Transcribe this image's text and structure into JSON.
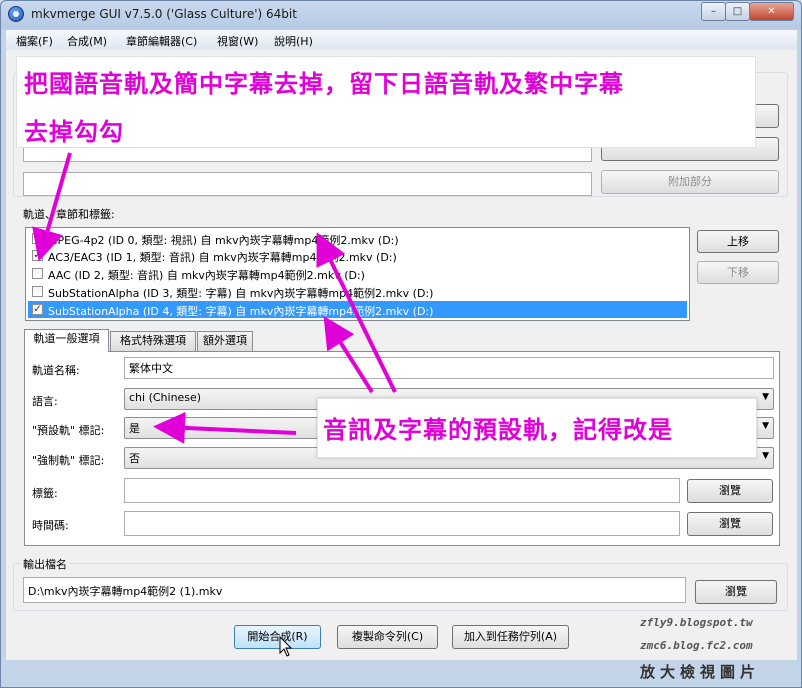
{
  "window": {
    "title": "mkvmerge GUI v7.5.0 ('Glass Culture') 64bit",
    "controls": {
      "minimize": "–",
      "maximize": "□",
      "close": "✕"
    }
  },
  "menu": [
    "檔案(F)",
    "合成(M)",
    "章節編輯器(C)",
    "視窗(W)",
    "說明(H)"
  ],
  "upper": {
    "append_button": "附加部分"
  },
  "tracks": {
    "label": "軌道、章節和標籤:",
    "items": [
      {
        "checked": true,
        "text": "MPEG-4p2 (ID 0, 類型: 視訊) 自 mkv內崁字幕轉mp4範例2.mkv (D:)",
        "selected": false
      },
      {
        "checked": true,
        "text": "AC3/EAC3 (ID 1, 類型: 音訊) 自 mkv內崁字幕轉mp4範例2.mkv (D:)",
        "selected": false
      },
      {
        "checked": false,
        "text": "AAC (ID 2, 類型: 音訊) 自 mkv內崁字幕轉mp4範例2.mkv (D:)",
        "selected": false
      },
      {
        "checked": false,
        "text": "SubStationAlpha (ID 3, 類型: 字幕) 自 mkv內崁字幕轉mp4範例2.mkv (D:)",
        "selected": false
      },
      {
        "checked": true,
        "text": "SubStationAlpha (ID 4, 類型: 字幕) 自 mkv內崁字幕轉mp4範例2.mkv (D:)",
        "selected": true
      }
    ],
    "up_button": "上移",
    "down_button": "下移"
  },
  "tabs": [
    "軌道一般選項",
    "格式特殊選項",
    "額外選項"
  ],
  "track_options": {
    "name_label": "軌道名稱:",
    "name_value": "繁体中文",
    "language_label": "語言:",
    "language_value": "chi (Chinese)",
    "default_label": "\"預設軌\" 標記:",
    "default_value": "是",
    "forced_label": "\"強制軌\" 標記:",
    "forced_value": "否",
    "tags_label": "標籤:",
    "tags_value": "",
    "tags_browse": "瀏覽",
    "timecodes_label": "時間碼:",
    "timecodes_value": "",
    "timecodes_browse": "瀏覽"
  },
  "output": {
    "label": "輸出檔名",
    "path": "D:\\mkv內崁字幕轉mp4範例2 (1).mkv",
    "browse": "瀏覽"
  },
  "actions": {
    "start": "開始合成(R)",
    "copy": "複製命令列(C)",
    "queue": "加入到任務佇列(A)"
  },
  "annotations": {
    "top_line1": "把國語音軌及簡中字幕去掉，留下日語音軌及繁中字幕",
    "top_line2": "去掉勾勾",
    "callout": "音訊及字幕的預設軌，記得改是",
    "color": "#e000d8"
  },
  "watermarks": {
    "line1": "zfly9.blogspot.tw",
    "line2": "zmc6.blog.fc2.com",
    "footer": "放大檢視圖片"
  }
}
